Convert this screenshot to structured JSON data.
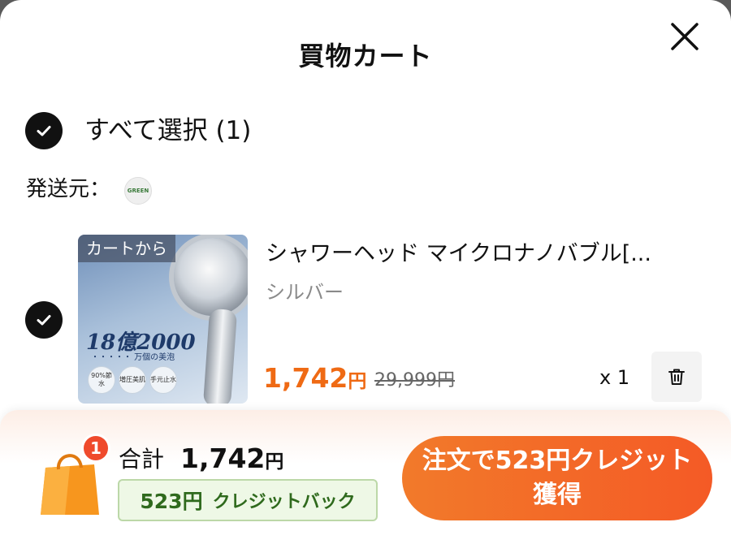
{
  "header": {
    "title": "買物カート"
  },
  "select_all": {
    "label": "すべて選択 (1)"
  },
  "shipping": {
    "label": "発送元：",
    "badge_text": "GREEN"
  },
  "item": {
    "thumb_tag": "カートから",
    "thumb_headline": "18億2000",
    "thumb_subline": "・・・・・ 万個の美泡",
    "thumb_badges": [
      "90%節水",
      "増圧美肌",
      "手元止水"
    ],
    "name": "シャワーヘッド マイクロナノバブル[...",
    "variant": "シルバー",
    "price_number": "1,742",
    "price_unit": "円",
    "old_price": "29,999円",
    "quantity": "x 1"
  },
  "footer": {
    "cart_count": "1",
    "total_label": "合計",
    "total_number": "1,742",
    "total_unit": "円",
    "credit_amount": "523円",
    "credit_label": "クレジットバック",
    "order_button": "注文で523円クレジット獲得"
  },
  "colors": {
    "accent": "#ef6a14",
    "button": "#f45a26",
    "credit_bg": "#eef8e6",
    "credit_text": "#2f6a1d"
  },
  "icons": {
    "close": "close-icon",
    "check": "check-icon",
    "trash": "trash-icon",
    "bag": "shopping-bag-icon"
  }
}
